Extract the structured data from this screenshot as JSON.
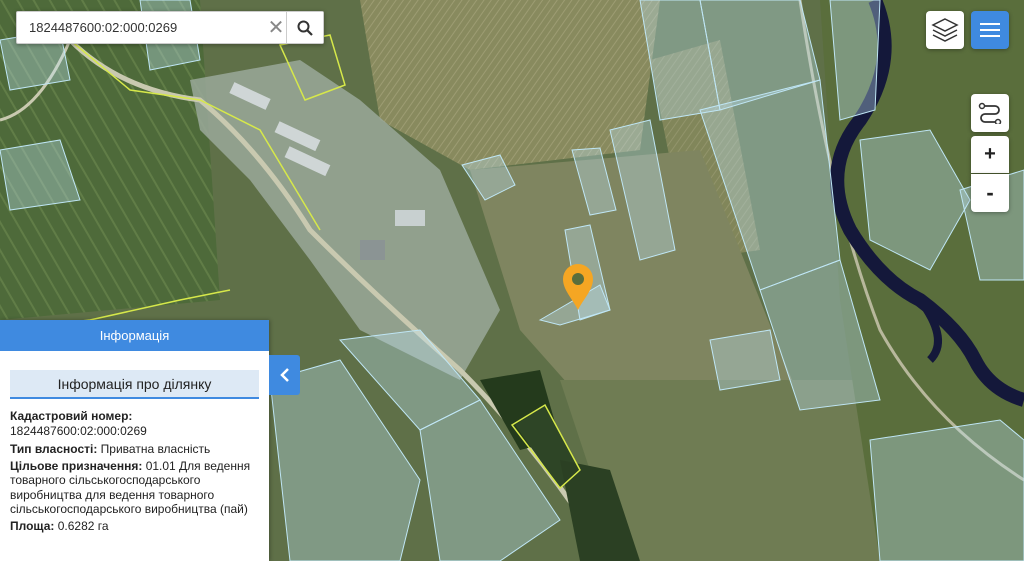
{
  "search": {
    "value": "1824487600:02:000:0269",
    "clear_symbol": "✕"
  },
  "controls": {
    "zoom_in_label": "+",
    "zoom_out_label": "-",
    "menu_color": "#3f8ae0"
  },
  "icons": {
    "search": "search-icon",
    "clear": "close-icon",
    "layers": "layers-icon",
    "menu": "hamburger-menu-icon",
    "route": "route-icon",
    "marker": "location-pin-icon",
    "toggle": "chevron-left-icon"
  },
  "info_panel": {
    "header": "Інформація",
    "subheader": "Інформація про ділянку",
    "cadastral_label": "Кадастровий номер:",
    "cadastral_value": "1824487600:02:000:0269",
    "ownership_label": "Тип власності:",
    "ownership_value": "Приватна власність",
    "purpose_label": "Цільове призначення:",
    "purpose_value": "01.01 Для ведення товарного сільськогосподарського виробництва для ведення товарного сільськогосподарського виробництва (пай)",
    "area_label": "Площа:",
    "area_value": "0.6282 га"
  },
  "map": {
    "marker_color": "#f5a623",
    "parcel_color": "#bfe6f5",
    "highlight_color": "#d6e84a",
    "river_color": "#14183a"
  }
}
